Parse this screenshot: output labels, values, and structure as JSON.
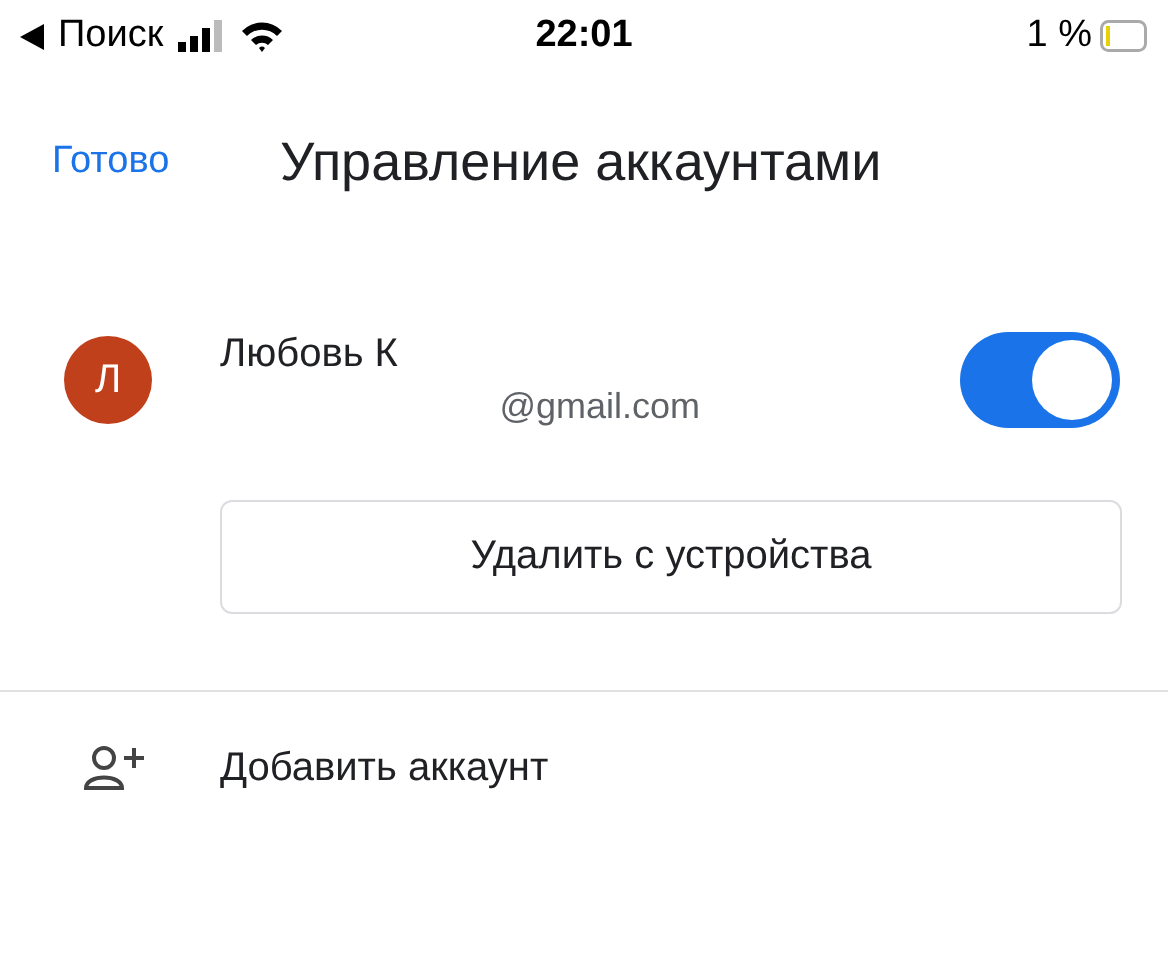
{
  "status_bar": {
    "back_label": "Поиск",
    "time": "22:01",
    "battery": "1 %"
  },
  "header": {
    "done": "Готово",
    "title": "Управление аккаунтами"
  },
  "account": {
    "initial": "Л",
    "name": "Любовь К",
    "email": "@gmail.com",
    "on": true
  },
  "remove_button": "Удалить с устройства",
  "add_account": "Добавить аккаунт"
}
